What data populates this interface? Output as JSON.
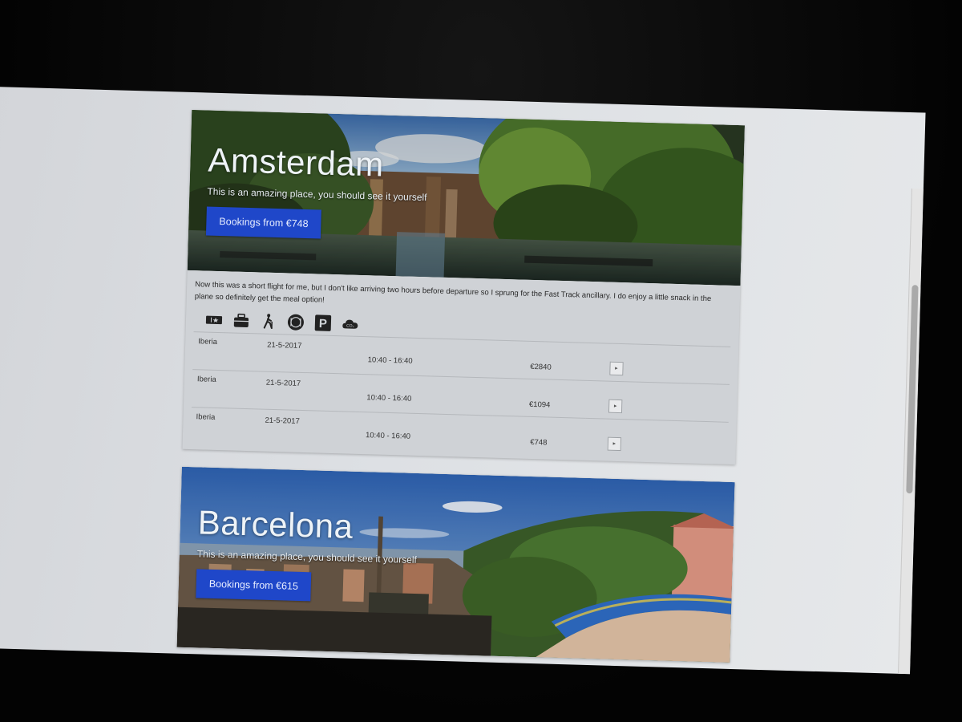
{
  "destinations": [
    {
      "city": "Amsterdam",
      "tagline": "This is an amazing place, you should see it yourself",
      "booking_label": "Bookings from €748",
      "review": "Now this was a short flight for me, but I don't like arriving two hours before departure so I sprung for the Fast Track ancillary. I do enjoy a little snack in the plane so definitely get the meal option!",
      "amenity_icons": [
        "ticket-icon",
        "luggage-icon",
        "walking-traveler-icon",
        "meal-icon",
        "parking-icon",
        "co2-cloud-icon"
      ],
      "parking_letter": "P",
      "co2_label": "CO₂",
      "flights": [
        {
          "airline": "Iberia",
          "date": "21-5-2017",
          "time": "10:40 - 16:40",
          "price": "€2840",
          "action": "▸"
        },
        {
          "airline": "Iberia",
          "date": "21-5-2017",
          "time": "10:40 - 16:40",
          "price": "€1094",
          "action": "▸"
        },
        {
          "airline": "Iberia",
          "date": "21-5-2017",
          "time": "10:40 - 16:40",
          "price": "€748",
          "action": "▸"
        }
      ]
    },
    {
      "city": "Barcelona",
      "tagline": "This is an amazing place, you should see it yourself",
      "booking_label": "Bookings from €615"
    }
  ],
  "colors": {
    "button": "#1f47c9",
    "card_background": "#cfd2d6",
    "page_background": "#dde0e4"
  }
}
